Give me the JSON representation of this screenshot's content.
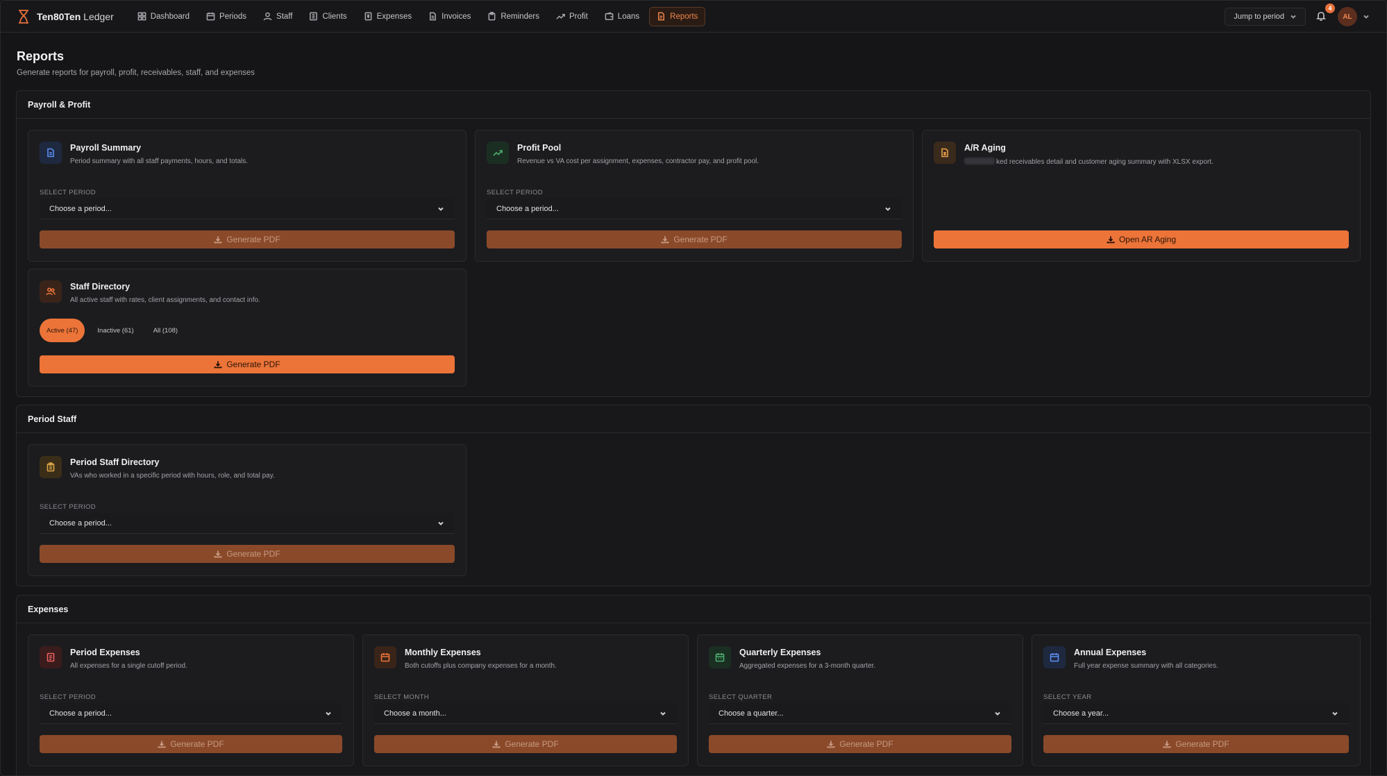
{
  "brand": {
    "name_bold": "Ten80Ten",
    "name_light": "Ledger"
  },
  "nav": [
    {
      "label": "Dashboard",
      "icon": "dashboard-icon"
    },
    {
      "label": "Periods",
      "icon": "calendar-icon"
    },
    {
      "label": "Staff",
      "icon": "user-icon"
    },
    {
      "label": "Clients",
      "icon": "building-icon"
    },
    {
      "label": "Expenses",
      "icon": "receipt-icon"
    },
    {
      "label": "Invoices",
      "icon": "file-icon"
    },
    {
      "label": "Reminders",
      "icon": "clipboard-icon"
    },
    {
      "label": "Profit",
      "icon": "trend-up-icon"
    },
    {
      "label": "Loans",
      "icon": "wallet-icon"
    },
    {
      "label": "Reports",
      "icon": "report-icon",
      "active": true
    }
  ],
  "topbar": {
    "jump_label": "Jump to period",
    "notification_count": "4",
    "avatar_initials": "AL"
  },
  "page": {
    "title": "Reports",
    "subtitle": "Generate reports for payroll, profit, receivables, staff, and expenses"
  },
  "sections": {
    "payroll_profit": {
      "title": "Payroll & Profit",
      "payroll_summary": {
        "title": "Payroll Summary",
        "desc": "Period summary with all staff payments, hours, and totals.",
        "label": "SELECT PERIOD",
        "select": "Choose a period...",
        "button": "Generate PDF"
      },
      "profit_pool": {
        "title": "Profit Pool",
        "desc": "Revenue vs VA cost per assignment, expenses, contractor pay, and profit pool.",
        "label": "SELECT PERIOD",
        "select": "Choose a period...",
        "button": "Generate PDF"
      },
      "ar_aging": {
        "title": "A/R Aging",
        "desc": "ked receivables detail and customer aging summary with XLSX export.",
        "button": "Open AR Aging"
      },
      "staff_directory": {
        "title": "Staff Directory",
        "desc": "All active staff with rates, client assignments, and contact info.",
        "filters": [
          "Active (47)",
          "Inactive (61)",
          "All (108)"
        ],
        "button": "Generate PDF"
      }
    },
    "period_staff": {
      "title": "Period Staff",
      "card": {
        "title": "Period Staff Directory",
        "desc": "VAs who worked in a specific period with hours, role, and total pay.",
        "label": "SELECT PERIOD",
        "select": "Choose a period...",
        "button": "Generate PDF"
      }
    },
    "expenses": {
      "title": "Expenses",
      "period": {
        "title": "Period Expenses",
        "desc": "All expenses for a single cutoff period.",
        "label": "SELECT PERIOD",
        "select": "Choose a period...",
        "button": "Generate PDF"
      },
      "monthly": {
        "title": "Monthly Expenses",
        "desc": "Both cutoffs plus company expenses for a month.",
        "label": "SELECT MONTH",
        "select": "Choose a month...",
        "button": "Generate PDF"
      },
      "quarterly": {
        "title": "Quarterly Expenses",
        "desc": "Aggregated expenses for a 3-month quarter.",
        "label": "SELECT QUARTER",
        "select": "Choose a quarter...",
        "button": "Generate PDF"
      },
      "annual": {
        "title": "Annual Expenses",
        "desc": "Full year expense summary with all categories.",
        "label": "SELECT YEAR",
        "select": "Choose a year...",
        "button": "Generate PDF"
      }
    }
  },
  "colors": {
    "accent": "#ec7438",
    "accent_dim": "#8a4a2a",
    "background": "#151517",
    "card": "#1c1c1f"
  }
}
